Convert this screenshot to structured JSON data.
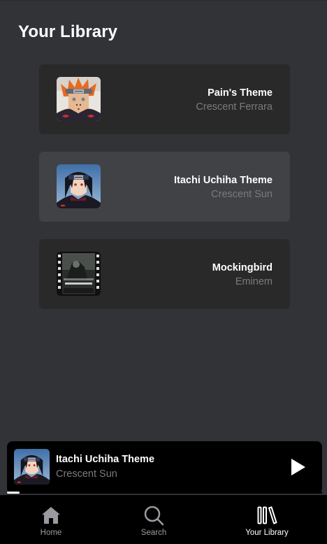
{
  "header": {
    "title": "Your Library"
  },
  "library": {
    "items": [
      {
        "title": "Pain's Theme",
        "artist": "Crescent Ferrara",
        "active": false
      },
      {
        "title": "Itachi Uchiha Theme",
        "artist": "Crescent Sun",
        "active": true
      },
      {
        "title": "Mockingbird",
        "artist": "Eminem",
        "active": false
      }
    ]
  },
  "player": {
    "title": "Itachi Uchiha Theme",
    "artist": "Crescent Sun",
    "state": "paused",
    "progress_percent": 4,
    "play_icon": "play-icon"
  },
  "nav": {
    "items": [
      {
        "label": "Home",
        "icon": "home-icon",
        "active": false
      },
      {
        "label": "Search",
        "icon": "search-icon",
        "active": false
      },
      {
        "label": "Your Library",
        "icon": "library-icon",
        "active": true
      }
    ]
  },
  "colors": {
    "background": "#323336",
    "card": "#29292a",
    "card_active": "#414246",
    "secondary_text": "#7b7b7f",
    "nav_background": "#000000"
  }
}
